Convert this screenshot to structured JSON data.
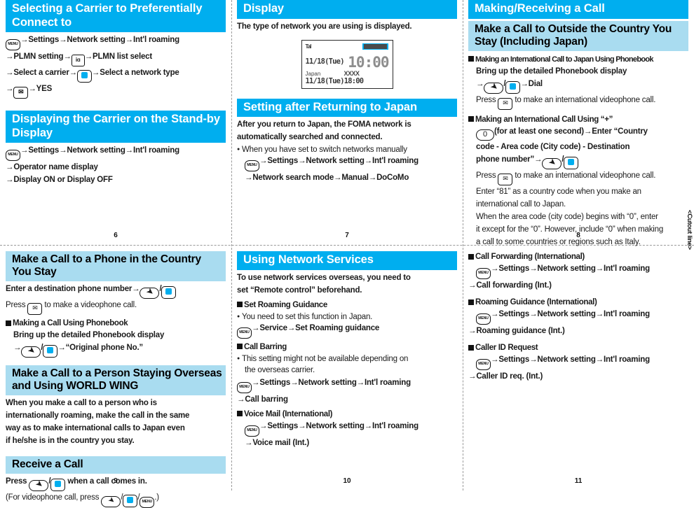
{
  "columns": {
    "c1_top": {
      "header": "Selecting a Carrier to Preferentially Connect to",
      "steps": [
        "Settings",
        "Network setting",
        "Int'l roaming",
        "PLMN setting",
        "PLMN list select",
        "Select a carrier",
        "Select a network type",
        "YES"
      ],
      "header2": "Displaying the Carrier on the Stand-by Display",
      "steps2": [
        "Settings",
        "Network setting",
        "Int'l roaming",
        "Operator name display",
        "Display ON or Display OFF"
      ],
      "page": "6"
    },
    "c2_top": {
      "header": "Display",
      "intro": "The type of network you are using is displayed.",
      "phone": {
        "signal": "Tal",
        "date1": "11/18(Tue)",
        "clock": "10:00",
        "country": "Japan",
        "carrier": "XXXX",
        "date2": "11/18(Tue)18:00"
      },
      "header2": "Setting after Returning to Japan",
      "body2_line1": "After you return to Japan, the FOMA network is",
      "body2_line2": "automatically searched and connected.",
      "bullet": "When you have set to switch networks manually",
      "steps2": [
        "Settings",
        "Network setting",
        "Int'l roaming",
        "Network search mode",
        "Manual",
        "DoCoMo"
      ],
      "page": "7"
    },
    "c3_top": {
      "header": "Making/Receiving a Call",
      "subheader": "Make a Call to Outside the Country You Stay (Including Japan)",
      "block1_title": "Making an International Call to Japan Using Phonebook",
      "block1_line1": "Bring up the detailed Phonebook display",
      "block1_dial": "Dial",
      "block1_note": "to make an international videophone call.",
      "block1_press": "Press",
      "block2_title": "Making an International Call Using “+”",
      "block2_l1a": "(for at least one second)",
      "block2_l1b": "Enter “Country",
      "block2_l2": "code - Area code (City code) - Destination",
      "block2_l3": "phone number”",
      "block2_n1a": "Press",
      "block2_n1b": "to make an international videophone call.",
      "block2_n2": "Enter “81” as a country code when you make an",
      "block2_n3": "international call to Japan.",
      "block2_n4": "When the area code (city code) begins with “0”, enter",
      "block2_n5": "it except for the “0”. However, include “0” when making",
      "block2_n6": "a call to some countries or regions such as Italy.",
      "page": "8"
    },
    "c1_bot": {
      "header": "Make a Call to a Phone in the Country You Stay",
      "line1": "Enter a destination phone number",
      "line2a": "Press",
      "line2b": "to make a videophone call.",
      "sq1": "Making a Call Using Phonebook",
      "sq1_line": "Bring up the detailed Phonebook display",
      "sq1_result": "“Original phone No.”",
      "header2": "Make a Call to a Person Staying Overseas and Using WORLD WING",
      "body2_l1": "When you make a call to a person who is",
      "body2_l2": "internationally roaming, make the call in the same",
      "body2_l3": "way as to make international calls to Japan even",
      "body2_l4": "if he/she is in the country you stay.",
      "header3": "Receive a Call",
      "recv_l1a": "Press",
      "recv_l1b": "when a call comes in.",
      "recv_l2a": "(For videophone call, press",
      "recv_l2b": ".)",
      "page": "9"
    },
    "c2_bot": {
      "header": "Using Network Services",
      "intro_l1": "To use network services overseas, you need to",
      "intro_l2": "set “Remote control” beforehand.",
      "sq1": "Set Roaming Guidance",
      "sq1_bullet": "You need to set this function in Japan.",
      "sq1_steps": [
        "Service",
        "Set Roaming guidance"
      ],
      "sq2": "Call Barring",
      "sq2_bullet_l1": "This setting might not be available depending on",
      "sq2_bullet_l2": "the overseas carrier.",
      "sq2_steps": [
        "Settings",
        "Network setting",
        "Int'l roaming",
        "Call barring"
      ],
      "sq3": "Voice Mail (International)",
      "sq3_steps": [
        "Settings",
        "Network setting",
        "Int'l roaming",
        "Voice mail (Int.)"
      ],
      "page": "10"
    },
    "c3_bot": {
      "sq1": "Call Forwarding (International)",
      "sq1_steps": [
        "Settings",
        "Network setting",
        "Int'l roaming",
        "Call forwarding (Int.)"
      ],
      "sq2": "Roaming Guidance (International)",
      "sq2_steps": [
        "Settings",
        "Network setting",
        "Int'l roaming",
        "Roaming guidance (Int.)"
      ],
      "sq3": "Caller ID Request",
      "sq3_steps": [
        "Settings",
        "Network setting",
        "Int'l roaming",
        "Caller ID req. (Int.)"
      ],
      "page": "11"
    }
  },
  "cutout_label": "<Cutout line>",
  "icons": {
    "menu": "MENU",
    "ia": "iα",
    "mail": "✉",
    "call": "↗",
    "ok": "center-key",
    "zero": "0"
  },
  "colors": {
    "header_blue": "#00AEEF",
    "subheader_blue": "#A9DCF0",
    "key_accent": "#00AEEF"
  }
}
